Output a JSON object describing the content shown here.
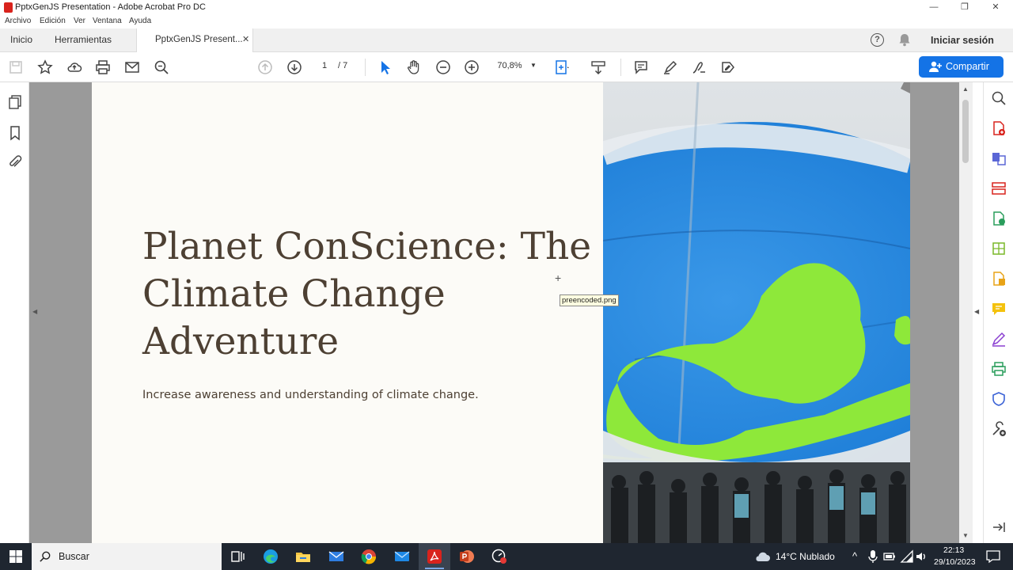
{
  "window": {
    "title": "PptxGenJS Presentation - Adobe Acrobat Pro DC",
    "minimize": "—",
    "maximize": "❐",
    "close": "✕"
  },
  "menu": [
    "Archivo",
    "Edición",
    "Ver",
    "Ventana",
    "Ayuda"
  ],
  "tabs": {
    "home": "Inicio",
    "tools": "Herramientas",
    "document": "PptxGenJS Present...",
    "document_close": "✕"
  },
  "account": {
    "help": "?",
    "sign_in": "Iniciar sesión"
  },
  "toolbar": {
    "page_current": "1",
    "page_total": "/ 7",
    "zoom": "70,8%",
    "zoom_arrow": "▼",
    "share_label": "Compartir"
  },
  "slide": {
    "title": "Planet ConScience: The Climate Change Adventure",
    "subtitle": "Increase awareness and understanding of climate change."
  },
  "tooltip": "preencoded.png",
  "cursor": "+",
  "scroll": {
    "up": "▲",
    "down": "▼",
    "left": "◀",
    "right": "◀"
  },
  "taskbar": {
    "search_label": "Buscar",
    "weather": "14°C Nublado",
    "time": "22:13",
    "date": "29/10/2023",
    "tray_arrow": "^"
  },
  "colors": {
    "share_blue": "#1473e6",
    "acrobat_red": "#d9231d",
    "title_brown": "#4d4033",
    "slide_bg": "#fcfbf7",
    "taskbar": "#1f2630"
  }
}
